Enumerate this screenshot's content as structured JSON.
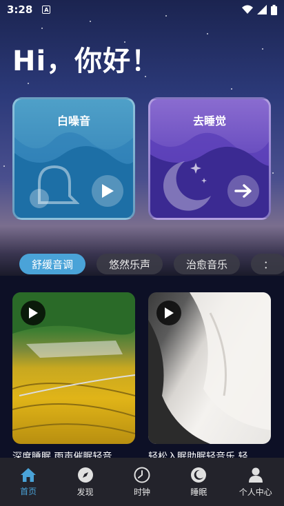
{
  "status_bar": {
    "time": "3:28",
    "notification_letter": "A"
  },
  "greeting": "Hi，你好！",
  "cards": [
    {
      "title": "白噪音",
      "icon": "bell-icon",
      "button_icon": "play-icon"
    },
    {
      "title": "去睡觉",
      "icon": "moon-icon",
      "button_icon": "arrow-right-icon"
    }
  ],
  "tabs": [
    {
      "label": "舒缓音调",
      "active": true
    },
    {
      "label": "悠然乐声",
      "active": false
    },
    {
      "label": "治愈音乐",
      "active": false
    },
    {
      "label": "：",
      "active": false
    }
  ],
  "items": [
    {
      "title": "深度睡眠 雨声催眠轻音",
      "image": "rice-terraces-image"
    },
    {
      "title": "轻松入眠助眠轻音乐 轻",
      "image": "sleeping-person-image"
    }
  ],
  "nav": [
    {
      "label": "首页",
      "icon": "home-icon",
      "active": true
    },
    {
      "label": "发现",
      "icon": "compass-icon",
      "active": false
    },
    {
      "label": "时钟",
      "icon": "clock-icon",
      "active": false
    },
    {
      "label": "睡眠",
      "icon": "moon-icon",
      "active": false
    },
    {
      "label": "个人中心",
      "icon": "person-icon",
      "active": false
    }
  ],
  "colors": {
    "accent": "#4aa3d8",
    "nav_bg": "#23232b",
    "page_bg": "#0d1026"
  }
}
